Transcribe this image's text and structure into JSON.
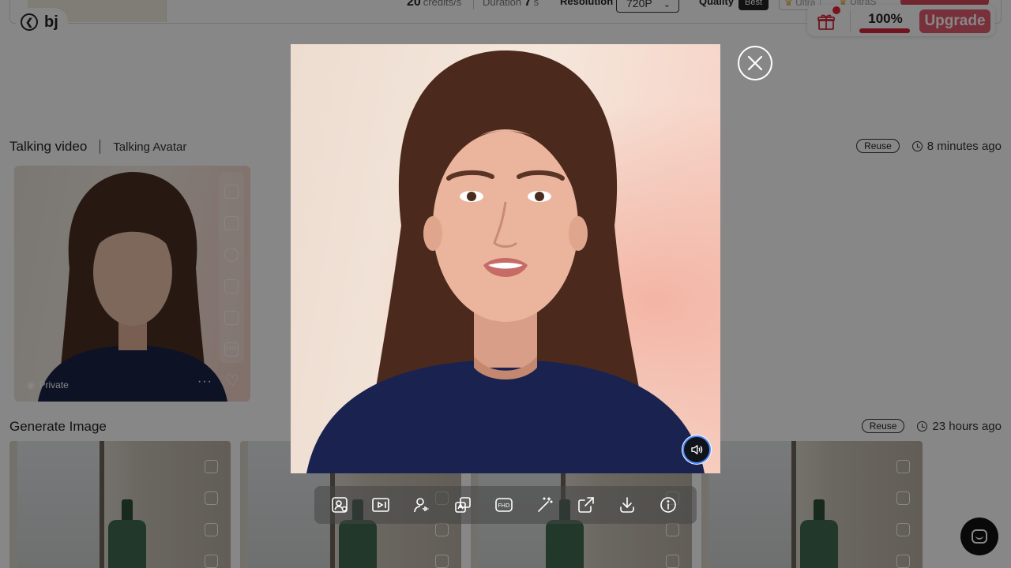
{
  "header": {
    "back_label": "bj",
    "credits_value": "20",
    "credits_unit": "credits/s",
    "duration_label": "Duration",
    "duration_value": "7",
    "duration_unit": "s",
    "resolution_label": "Resolution",
    "resolution_value": "720P",
    "quality_label": "Quality",
    "quality_value": "Best",
    "ultra_label": "Ultra",
    "ultras_label": "UltraS"
  },
  "promo": {
    "percent_label": "100%",
    "progress_fraction": 1.0,
    "upgrade_label": "Upgrade"
  },
  "sections": [
    {
      "title": "Talking video",
      "subtitle": "Talking Avatar",
      "reuse_label": "Reuse",
      "time_ago": "8 minutes ago",
      "card": {
        "visibility_label": "Private"
      }
    },
    {
      "title": "Generate Image",
      "reuse_label": "Reuse",
      "time_ago": "23 hours ago"
    }
  ],
  "modal": {
    "action_icons": [
      "face-swap-icon",
      "video-enhance-icon",
      "avatar-voice-icon",
      "translate-icon",
      "fhd-upscale-icon",
      "magic-wand-icon",
      "share-icon",
      "download-icon",
      "info-icon"
    ],
    "fhd_text": "FHD"
  },
  "colors": {
    "accent": "#e35b6e",
    "progress": "#d6263d",
    "sound_ring": "#4a8bff"
  }
}
